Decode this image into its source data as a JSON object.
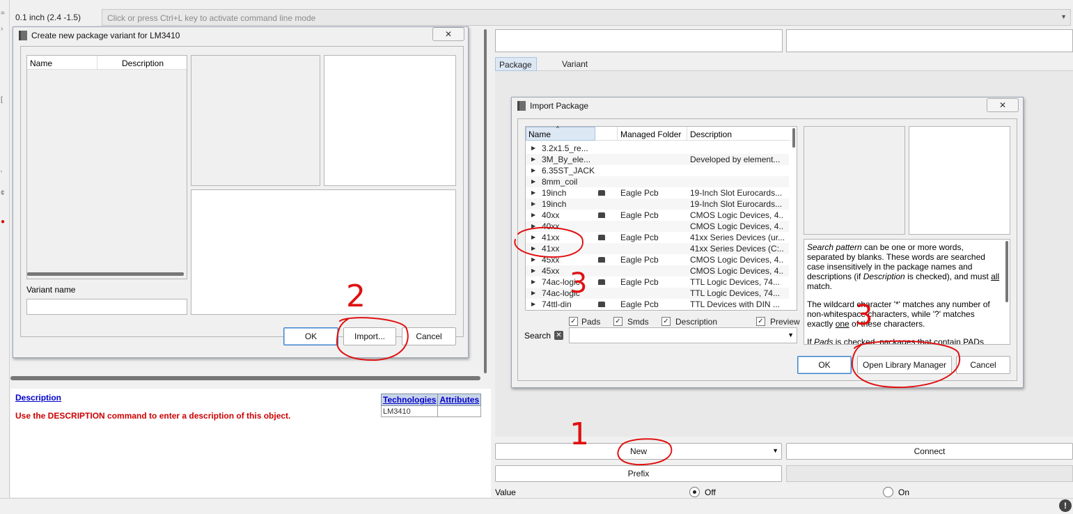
{
  "toolbar": {
    "coordinate": "0.1 inch (2.4 -1.5)",
    "command_placeholder": "Click or press Ctrl+L key to activate command line mode"
  },
  "variant_dialog": {
    "title": "Create new package variant for LM3410",
    "columns": [
      "Name",
      "Description"
    ],
    "variant_name_label": "Variant name",
    "variant_name_value": "",
    "ok_label": "OK",
    "import_label": "Import...",
    "cancel_label": "Cancel"
  },
  "description_panel": {
    "link": "Description",
    "text": "Use the DESCRIPTION command to enter a description of this object.",
    "table_headers": [
      "Technologies",
      "Attributes"
    ],
    "table_row": [
      "LM3410",
      ""
    ]
  },
  "right_panel": {
    "tabs": [
      "Package",
      "Variant"
    ],
    "new_label": "New",
    "connect_label": "Connect",
    "prefix_label": "Prefix",
    "value_label": "Value",
    "value_options": [
      "Off",
      "On"
    ],
    "value_selected": "Off"
  },
  "import_dialog": {
    "title": "Import Package",
    "columns": [
      "Name",
      "Managed Folder",
      "Description"
    ],
    "rows": [
      {
        "name": "3.2x1.5_re...",
        "folder": "",
        "desc": "",
        "managed": false
      },
      {
        "name": "3M_By_ele...",
        "folder": "",
        "desc": "Developed by element...",
        "managed": false
      },
      {
        "name": "6.35ST_JACK",
        "folder": "",
        "desc": "",
        "managed": false
      },
      {
        "name": "8mm_coil",
        "folder": "",
        "desc": "",
        "managed": false
      },
      {
        "name": "19inch",
        "folder": "Eagle Pcb",
        "desc": "19-Inch Slot Eurocards...",
        "managed": true
      },
      {
        "name": "19inch",
        "folder": "",
        "desc": "19-Inch Slot Eurocards...",
        "managed": false
      },
      {
        "name": "40xx",
        "folder": "Eagle Pcb",
        "desc": "CMOS Logic Devices, 4...",
        "managed": true
      },
      {
        "name": "40xx",
        "folder": "",
        "desc": "CMOS Logic Devices, 4...",
        "managed": false
      },
      {
        "name": "41xx",
        "folder": "Eagle Pcb",
        "desc": "41xx Series Devices (ur...",
        "managed": true
      },
      {
        "name": "41xx",
        "folder": "",
        "desc": "41xx Series Devices (C:...",
        "managed": false
      },
      {
        "name": "45xx",
        "folder": "Eagle Pcb",
        "desc": "CMOS Logic Devices, 4...",
        "managed": true
      },
      {
        "name": "45xx",
        "folder": "",
        "desc": "CMOS Logic Devices, 4...",
        "managed": false
      },
      {
        "name": "74ac-logic",
        "folder": "Eagle Pcb",
        "desc": "TTL Logic Devices, 74...",
        "managed": true
      },
      {
        "name": "74ac-logic",
        "folder": "",
        "desc": "TTL Logic Devices, 74...",
        "managed": false
      },
      {
        "name": "74ttl-din",
        "folder": "Eagle Pcb",
        "desc": "TTL Devices with DIN ...",
        "managed": true
      }
    ],
    "filters": [
      {
        "label": "Pads",
        "checked": true
      },
      {
        "label": "Smds",
        "checked": true
      },
      {
        "label": "Description",
        "checked": true
      },
      {
        "label": "Preview",
        "checked": true
      }
    ],
    "search_label": "Search",
    "search_value": "",
    "help_p1_em1": "Search pattern",
    "help_p1_a": " can be one or more words, separated by blanks. These words are searched case insensitively in the package names and descriptions (if ",
    "help_p1_em2": "Description",
    "help_p1_b": " is checked), and must ",
    "help_p1_u": "all",
    "help_p1_c": " match.",
    "help_p2_a": "The wildcard character '*' matches any number of non-whitespace characters, while '?' matches exactly ",
    "help_p2_u": "one",
    "help_p2_b": " of these characters.",
    "help_p3_a": "If ",
    "help_p3_em": "Pads",
    "help_p3_b": " is checked, packages that contain PADs",
    "ok_label": "OK",
    "library_manager_label": "Open Library Manager",
    "cancel_label": "Cancel"
  },
  "annotations": [
    "1",
    "2",
    "3"
  ],
  "colors": {
    "annotation": "#e01010",
    "link": "#0000cc",
    "desc_text": "#cc0000",
    "primary_border": "#3c7fc9"
  }
}
